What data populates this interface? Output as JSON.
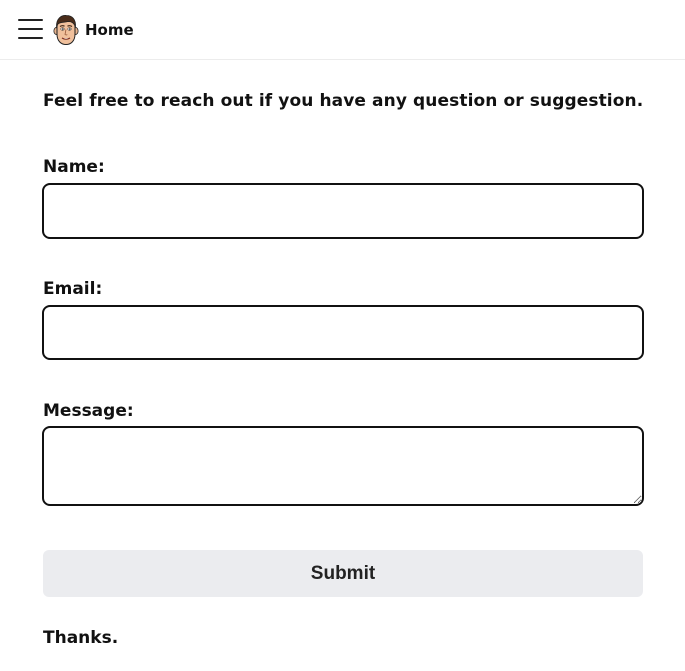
{
  "header": {
    "home_label": "Home"
  },
  "intro_text": "Feel free to reach out if you have any question or suggestion.",
  "form": {
    "name_label": "Name:",
    "name_value": "",
    "email_label": "Email:",
    "email_value": "",
    "message_label": "Message:",
    "message_value": "",
    "submit_label": "Submit"
  },
  "footer_text": "Thanks.",
  "icons": {
    "menu": "hamburger-menu-icon",
    "avatar": "cartoon-face-avatar"
  },
  "colors": {
    "input_border": "#111111",
    "button_bg": "#ebecef",
    "text": "#111111"
  }
}
